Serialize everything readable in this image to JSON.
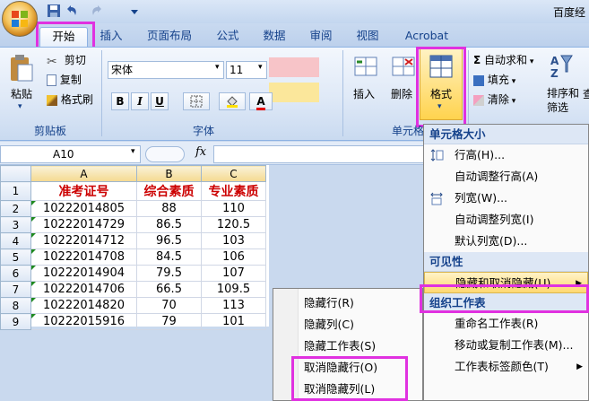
{
  "titlebar": {
    "title": "百度经"
  },
  "tabs": [
    "开始",
    "插入",
    "页面布局",
    "公式",
    "数据",
    "审阅",
    "视图",
    "Acrobat"
  ],
  "clipboard": {
    "paste": "粘贴",
    "cut": "剪切",
    "copy": "复制",
    "format_painter": "格式刷",
    "group": "剪贴板"
  },
  "font": {
    "name": "宋体",
    "size": "11",
    "bold": "B",
    "italic": "I",
    "underline": "U",
    "group": "字体"
  },
  "cells": {
    "insert": "插入",
    "delete": "删除",
    "format": "格式",
    "group": "单元格"
  },
  "editing": {
    "autosum": "自动求和",
    "fill": "填充",
    "clear": "清除",
    "sort_filter": "排序和\n筛选",
    "find": "查"
  },
  "formula": {
    "namebox": "A10",
    "fx": "fx"
  },
  "sheet": {
    "columns": [
      "A",
      "B",
      "C"
    ],
    "rows": [
      [
        "准考证号",
        "综合素质",
        "专业素质"
      ],
      [
        "10222014805",
        "88",
        "110"
      ],
      [
        "10222014729",
        "86.5",
        "120.5"
      ],
      [
        "10222014712",
        "96.5",
        "103"
      ],
      [
        "10222014708",
        "84.5",
        "106"
      ],
      [
        "10222014904",
        "79.5",
        "107"
      ],
      [
        "10222014706",
        "66.5",
        "109.5"
      ],
      [
        "10222014820",
        "70",
        "113"
      ],
      [
        "10222015916",
        "79",
        "101"
      ]
    ]
  },
  "format_menu": {
    "section1": "单元格大小",
    "row_height": "行高(H)...",
    "autofit_row": "自动调整行高(A)",
    "col_width": "列宽(W)...",
    "autofit_col": "自动调整列宽(I)",
    "default_width": "默认列宽(D)...",
    "section2": "可见性",
    "hide_unhide": "隐藏和取消隐藏(U)",
    "section3": "组织工作表",
    "rename": "重命名工作表(R)",
    "move_copy": "移动或复制工作表(M)...",
    "tab_color": "工作表标签颜色(T)"
  },
  "hide_menu": {
    "hide_rows": "隐藏行(R)",
    "hide_cols": "隐藏列(C)",
    "hide_sheet": "隐藏工作表(S)",
    "unhide_rows": "取消隐藏行(O)",
    "unhide_cols": "取消隐藏列(L)"
  },
  "colors": {
    "highlight": "#e031e0",
    "header_red": "#cc0000",
    "accent": "#15428b"
  }
}
